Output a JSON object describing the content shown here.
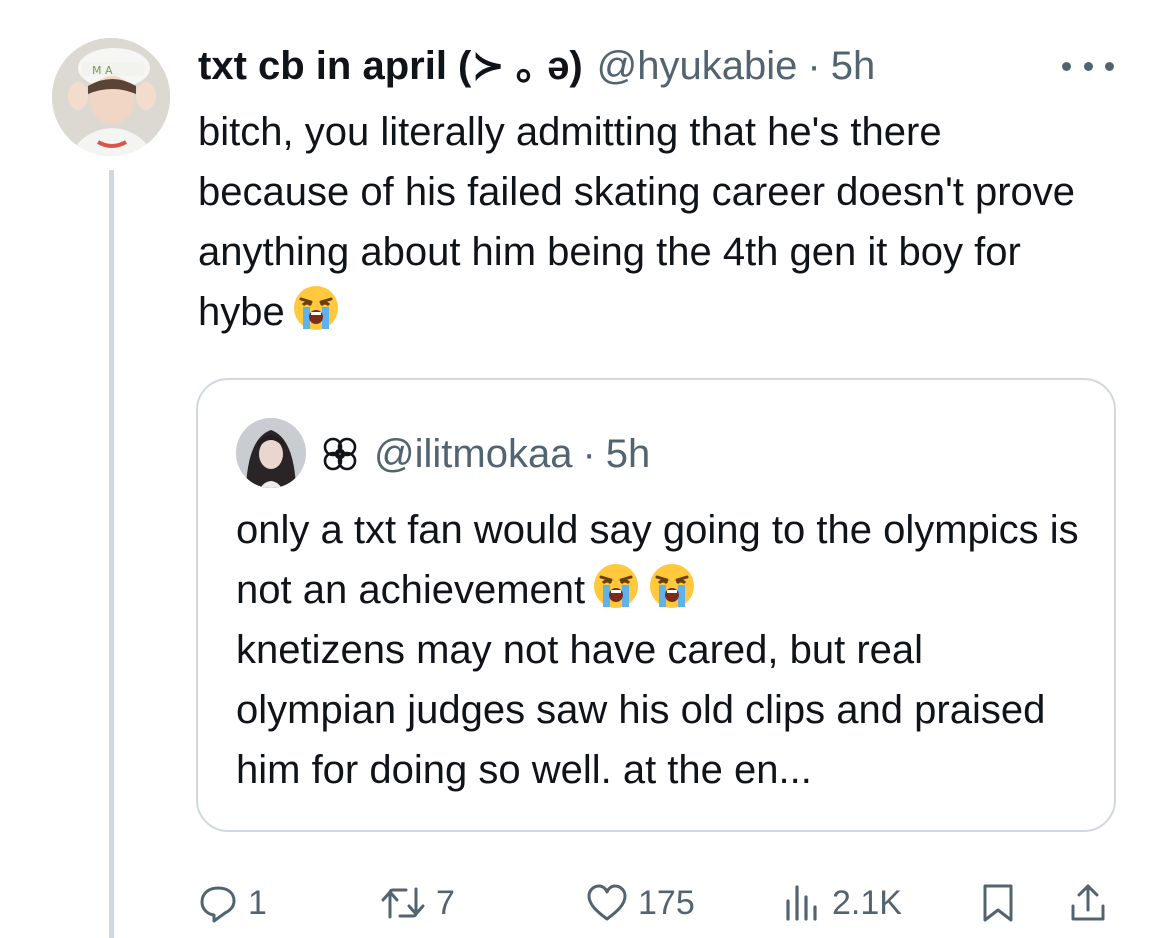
{
  "tweet": {
    "display_name": "txt cb in april (≻ ｡ ə)",
    "handle": "@hyukabie",
    "separator": "·",
    "time": "5h",
    "text": "bitch, you literally admitting that he's there because of his failed skating career doesn't prove anything about him being the 4th gen it boy for hybe",
    "emoji": "loudly-crying-face"
  },
  "quote": {
    "handle": "@ilitmokaa",
    "separator": "·",
    "time": "5h",
    "name_symbol": "flower-icon",
    "text_line1": "only a txt fan would say going to the olympics is not an achievement",
    "emoji_count": 2,
    "text_line2": "knetizens may not have cared, but real olympian judges saw his old clips and praised him for doing so well. at the en..."
  },
  "actions": {
    "replies": "1",
    "reposts": "7",
    "likes": "175",
    "views": "2.1K"
  },
  "colors": {
    "text": "#0f1419",
    "secondary": "#536471",
    "border": "#cfd9de",
    "background": "#ffffff"
  }
}
